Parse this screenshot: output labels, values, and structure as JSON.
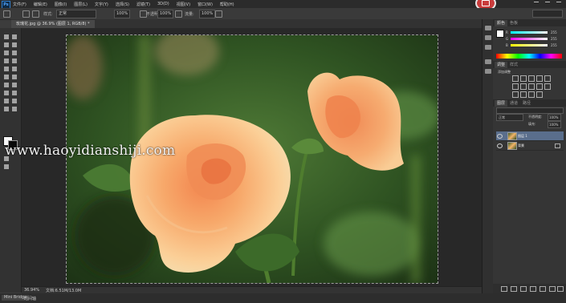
{
  "app": {
    "logo": "Ps"
  },
  "menu": {
    "items": [
      "文件(F)",
      "编辑(E)",
      "图像(I)",
      "图层(L)",
      "文字(Y)",
      "选择(S)",
      "滤镜(T)",
      "3D(D)",
      "视图(V)",
      "窗口(W)",
      "帮助(H)"
    ]
  },
  "options": {
    "style_label": "样式:",
    "style_value": "正常",
    "zoom_value": "100%",
    "opacity_label": "不透明度:",
    "opacity_value": "100%",
    "flow_label": "流量:",
    "flow_value": "100%"
  },
  "document": {
    "tab_title": "玫瑰花.jpg @ 36.9% (图层 1, RGB/8) *",
    "zoom": "36.94%",
    "info": "文档:6.51M/13.0M"
  },
  "bottom": {
    "minibridge": "Mini Bridge",
    "timeline": "时间轴"
  },
  "watermark": "www.haoyidianshiji.com",
  "panels": {
    "color_tabs": [
      "颜色",
      "色板"
    ],
    "color_values": {
      "r": "255",
      "g": "255",
      "b": "255"
    },
    "adjust_tabs": [
      "调整",
      "样式"
    ],
    "adjust_title": "添加调整",
    "layer_tabs": [
      "图层",
      "通道",
      "路径"
    ],
    "blend_mode": "正常",
    "opacity_label": "不透明度:",
    "opacity_value": "100%",
    "fill_label": "填充:",
    "fill_value": "100%",
    "layers": [
      {
        "name": "图层 1",
        "selected": true
      },
      {
        "name": "背景",
        "selected": false
      }
    ]
  }
}
